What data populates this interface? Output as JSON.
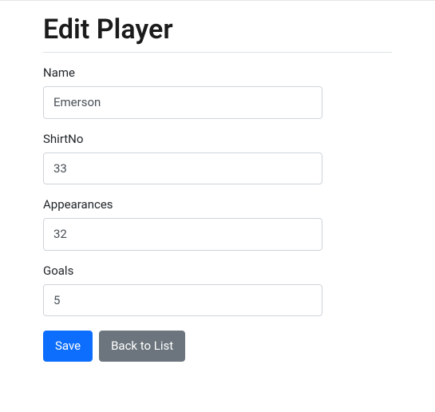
{
  "page": {
    "title": "Edit Player"
  },
  "form": {
    "fields": {
      "name": {
        "label": "Name",
        "value": "Emerson"
      },
      "shirtNo": {
        "label": "ShirtNo",
        "value": "33"
      },
      "appearances": {
        "label": "Appearances",
        "value": "32"
      },
      "goals": {
        "label": "Goals",
        "value": "5"
      }
    }
  },
  "actions": {
    "save": "Save",
    "back": "Back to List"
  }
}
